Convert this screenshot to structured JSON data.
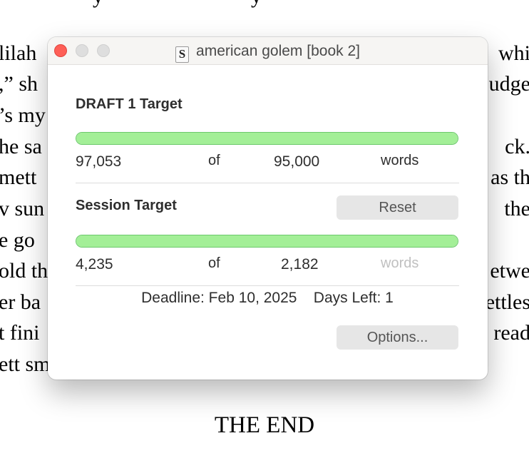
{
  "background": {
    "lines_left": [
      "lilah",
      ",” sh",
      "’s my",
      "he sa",
      "mett",
      "v sun",
      "e go",
      "old th",
      "er ba",
      "t fini",
      "ett sm"
    ],
    "lines_right": [
      "whi",
      "udge",
      "",
      "ck. ",
      "as th",
      " the ",
      "",
      "etwe",
      "ettles",
      "read",
      ""
    ],
    "the_end": "THE END"
  },
  "window": {
    "title": "american golem [book 2]",
    "doc_icon_glyph": "S"
  },
  "draft_target": {
    "title": "DRAFT 1 Target",
    "current": "97,053",
    "of_label": "of",
    "target": "95,000",
    "unit": "words",
    "progress_fraction": 1.0
  },
  "session_target": {
    "title": "Session Target",
    "reset_label": "Reset",
    "current": "4,235",
    "of_label": "of",
    "target": "2,182",
    "unit": "words",
    "progress_fraction": 1.0
  },
  "deadline": {
    "label": "Deadline: Feb 10, 2025",
    "days_left": "Days Left: 1"
  },
  "options_label": "Options...",
  "colors": {
    "progress_fill": "#a3ef97",
    "progress_border": "#6cc96c",
    "close_button": "#fe5f57"
  }
}
